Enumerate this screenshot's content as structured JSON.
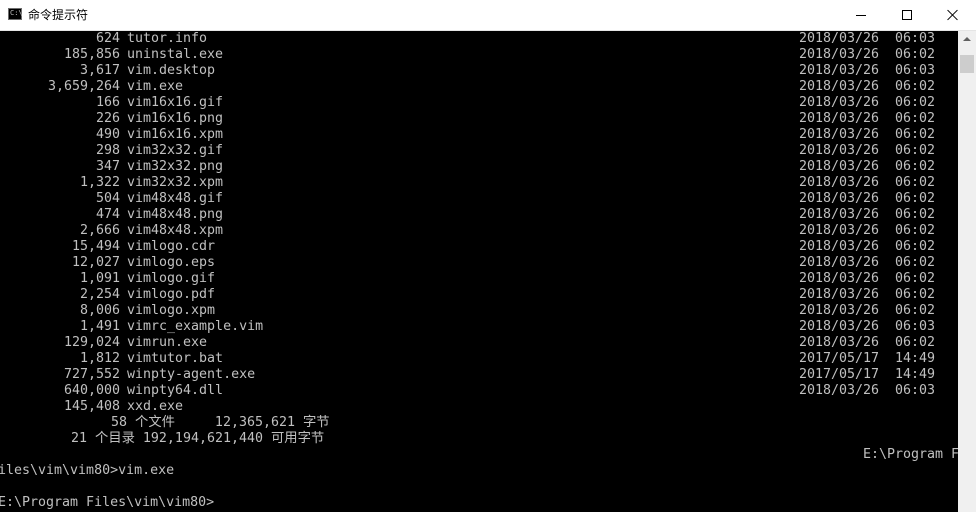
{
  "window": {
    "title": "命令提示符"
  },
  "listing": [
    {
      "size": "624",
      "name": "tutor.info",
      "date": "2018/03/26",
      "time": "06:03"
    },
    {
      "size": "185,856",
      "name": "uninstal.exe",
      "date": "2018/03/26",
      "time": "06:02"
    },
    {
      "size": "3,617",
      "name": "vim.desktop",
      "date": "2018/03/26",
      "time": "06:03"
    },
    {
      "size": "3,659,264",
      "name": "vim.exe",
      "date": "2018/03/26",
      "time": "06:02"
    },
    {
      "size": "166",
      "name": "vim16x16.gif",
      "date": "2018/03/26",
      "time": "06:02"
    },
    {
      "size": "226",
      "name": "vim16x16.png",
      "date": "2018/03/26",
      "time": "06:02"
    },
    {
      "size": "490",
      "name": "vim16x16.xpm",
      "date": "2018/03/26",
      "time": "06:02"
    },
    {
      "size": "298",
      "name": "vim32x32.gif",
      "date": "2018/03/26",
      "time": "06:02"
    },
    {
      "size": "347",
      "name": "vim32x32.png",
      "date": "2018/03/26",
      "time": "06:02"
    },
    {
      "size": "1,322",
      "name": "vim32x32.xpm",
      "date": "2018/03/26",
      "time": "06:02"
    },
    {
      "size": "504",
      "name": "vim48x48.gif",
      "date": "2018/03/26",
      "time": "06:02"
    },
    {
      "size": "474",
      "name": "vim48x48.png",
      "date": "2018/03/26",
      "time": "06:02"
    },
    {
      "size": "2,666",
      "name": "vim48x48.xpm",
      "date": "2018/03/26",
      "time": "06:02"
    },
    {
      "size": "15,494",
      "name": "vimlogo.cdr",
      "date": "2018/03/26",
      "time": "06:02"
    },
    {
      "size": "12,027",
      "name": "vimlogo.eps",
      "date": "2018/03/26",
      "time": "06:02"
    },
    {
      "size": "1,091",
      "name": "vimlogo.gif",
      "date": "2018/03/26",
      "time": "06:02"
    },
    {
      "size": "2,254",
      "name": "vimlogo.pdf",
      "date": "2018/03/26",
      "time": "06:02"
    },
    {
      "size": "8,006",
      "name": "vimlogo.xpm",
      "date": "2018/03/26",
      "time": "06:02"
    },
    {
      "size": "1,491",
      "name": "vimrc_example.vim",
      "date": "2018/03/26",
      "time": "06:03"
    },
    {
      "size": "129,024",
      "name": "vimrun.exe",
      "date": "2018/03/26",
      "time": "06:02"
    },
    {
      "size": "1,812",
      "name": "vimtutor.bat",
      "date": "2017/05/17",
      "time": "14:49"
    },
    {
      "size": "727,552",
      "name": "winpty-agent.exe",
      "date": "2017/05/17",
      "time": "14:49"
    },
    {
      "size": "640,000",
      "name": "winpty64.dll",
      "date": "2018/03/26",
      "time": "06:03"
    },
    {
      "size": "145,408",
      "name": "xxd.exe",
      "date": "",
      "time": ""
    }
  ],
  "summary": {
    "files": "58 个文件     12,365,621 字节",
    "dirs": "21 个目录 192,194,621,440 可用字节"
  },
  "wrapped_path": "E:\\Program F",
  "command_line": "iles\\vim\\vim80>vim.exe",
  "prompt": "E:\\Program Files\\vim\\vim80>"
}
